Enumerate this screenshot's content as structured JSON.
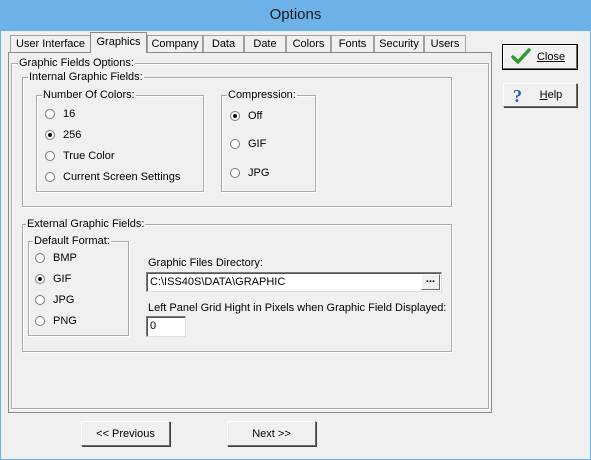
{
  "window": {
    "title": "Options"
  },
  "tabs": [
    {
      "label": "User Interface"
    },
    {
      "label": "Graphics"
    },
    {
      "label": "Company"
    },
    {
      "label": "Data"
    },
    {
      "label": "Date"
    },
    {
      "label": "Colors"
    },
    {
      "label": "Fonts"
    },
    {
      "label": "Security"
    },
    {
      "label": "Users"
    }
  ],
  "active_tab": "Graphics",
  "graphic_fields_options": {
    "label": "Graphic Fields Options:",
    "internal": {
      "label": "Internal Graphic Fields:",
      "colors": {
        "label": "Number Of Colors:",
        "options": [
          "16",
          "256",
          "True Color",
          "Current Screen Settings"
        ],
        "selected": "256"
      },
      "compression": {
        "label": "Compression:",
        "options": [
          "Off",
          "GIF",
          "JPG"
        ],
        "selected": "Off"
      }
    },
    "external": {
      "label": "External Graphic Fields:",
      "format": {
        "label": "Default Format:",
        "options": [
          "BMP",
          "GIF",
          "JPG",
          "PNG"
        ],
        "selected": "GIF"
      },
      "directory": {
        "label": "Graphic Files Directory:",
        "value": "C:\\ISS40S\\DATA\\GRAPHIC",
        "browse_label": "..."
      },
      "grid_height": {
        "label": "Left Panel Grid Hight in Pixels when Graphic Field Displayed:",
        "value": "0"
      }
    }
  },
  "side_buttons": {
    "close": "Close",
    "help": "Help"
  },
  "nav_buttons": {
    "previous": "<< Previous",
    "next": "Next >>"
  },
  "colors": {
    "titlebar": "#6cb2e8",
    "close_check": "#2e9b2e",
    "help_mark": "#1f5fbf"
  }
}
